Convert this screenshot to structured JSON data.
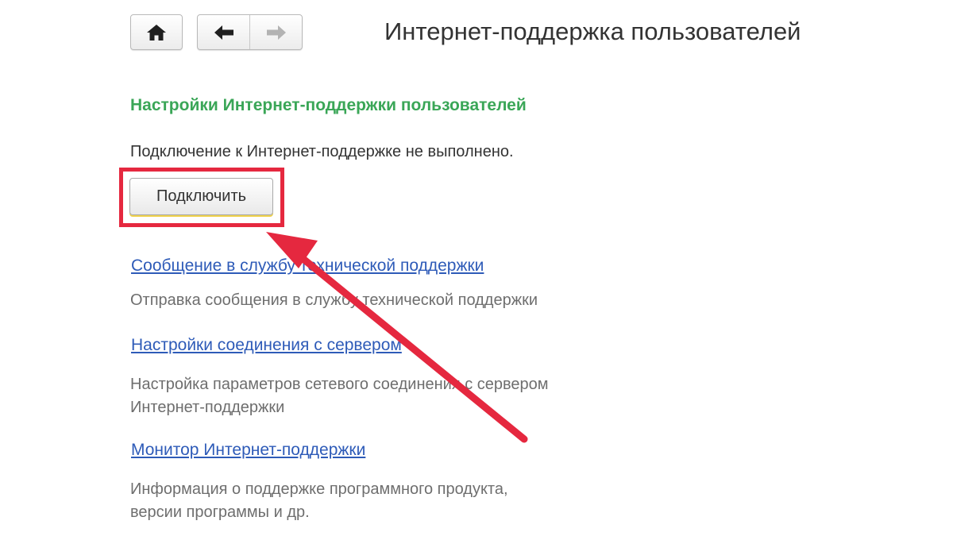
{
  "header": {
    "title": "Интернет-поддержка пользователей",
    "home_icon": "home-icon",
    "back_icon": "arrow-left-icon",
    "forward_icon": "arrow-right-icon"
  },
  "section": {
    "title": "Настройки Интернет-поддержки пользователей",
    "status": "Подключение к Интернет-поддержке не выполнено.",
    "connect_label": "Подключить"
  },
  "links": [
    {
      "label": "Сообщение в службу технической поддержки",
      "desc_lines": [
        "Отправка сообщения в службу технической поддержки"
      ]
    },
    {
      "label": "Настройки соединения с сервером",
      "desc_lines": [
        "Настройка параметров сетевого соединения с сервером",
        "Интернет-поддержки"
      ]
    },
    {
      "label": "Монитор Интернет-поддержки",
      "desc_lines": [
        "Информация о поддержке программного продукта,",
        "версии программы и др."
      ]
    }
  ],
  "colors": {
    "section_title": "#3aa657",
    "link": "#2e5bb8",
    "annotation": "#e5283f"
  }
}
